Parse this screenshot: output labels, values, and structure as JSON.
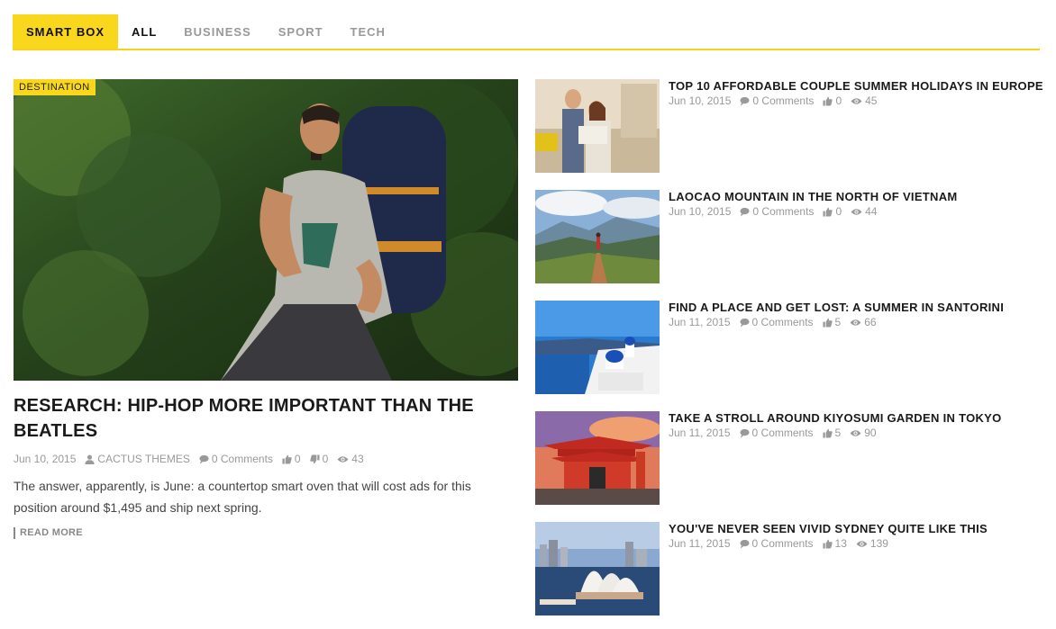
{
  "tabs": {
    "brand": "SMART BOX",
    "items": [
      "ALL",
      "BUSINESS",
      "SPORT",
      "TECH"
    ]
  },
  "feature": {
    "badge": "DESTINATION",
    "title": "RESEARCH: HIP-HOP MORE IMPORTANT THAN THE BEATLES",
    "date": "Jun 10, 2015",
    "author": "CACTUS THEMES",
    "comments": "0 Comments",
    "likes": "0",
    "dislikes": "0",
    "views": "43",
    "excerpt": "The answer, apparently, is June: a countertop smart oven that will cost ads for this position around $1,495 and ship next spring.",
    "read_more": "READ MORE"
  },
  "side": [
    {
      "title": "TOP 10 AFFORDABLE COUPLE SUMMER HOLIDAYS IN EUROPE",
      "date": "Jun 10, 2015",
      "comments": "0 Comments",
      "likes": "0",
      "views": "45"
    },
    {
      "title": "LAOCAO MOUNTAIN IN THE NORTH OF VIETNAM",
      "date": "Jun 10, 2015",
      "comments": "0 Comments",
      "likes": "0",
      "views": "44"
    },
    {
      "title": "FIND A PLACE AND GET LOST: A SUMMER IN SANTORINI",
      "date": "Jun 11, 2015",
      "comments": "0 Comments",
      "likes": "5",
      "views": "66"
    },
    {
      "title": "TAKE A STROLL AROUND KIYOSUMI GARDEN IN TOKYO",
      "date": "Jun 11, 2015",
      "comments": "0 Comments",
      "likes": "5",
      "views": "90"
    },
    {
      "title": "YOU'VE NEVER SEEN VIVID SYDNEY QUITE LIKE THIS",
      "date": "Jun 11, 2015",
      "comments": "0 Comments",
      "likes": "13",
      "views": "139"
    }
  ],
  "colors": {
    "accent": "#f9d71c",
    "meta": "#999999"
  }
}
